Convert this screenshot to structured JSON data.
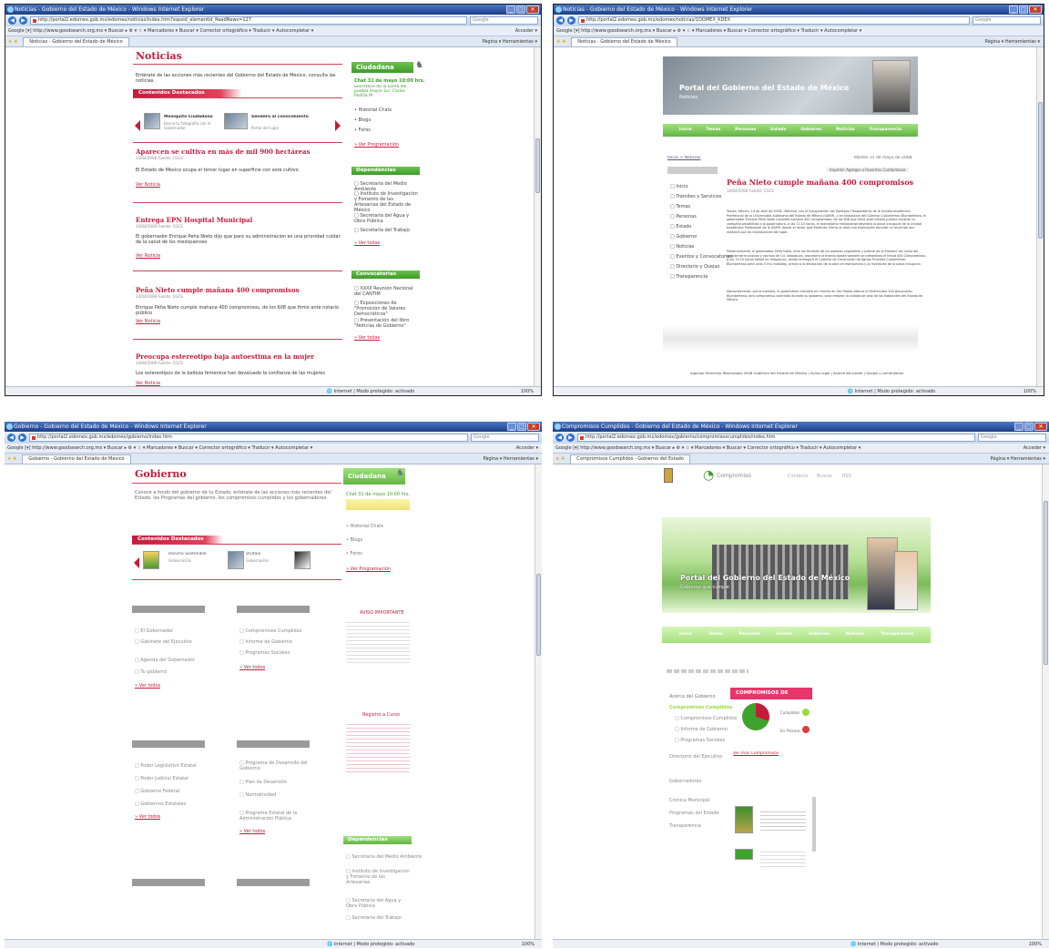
{
  "panel1": {
    "window_title": "Noticias - Gobierno del Estado de México - Windows Internet Explorer",
    "url": "http://portal2.edomex.gob.mx/edomex/noticias/index.htm?sspoid_elementId_ReadNews=127",
    "search_placeholder": "Google",
    "google_bar": "Google  [▾] http://www.goodsearch.org.mx   ▾ Buscar ▸ ⚙ ▾ ☆ ▾ Marcadores ▾  Buscar ▾  Corrector ortográfico ▾  Traducir ▾  Autocompletar ▾",
    "google_right": "Acceder ▾",
    "tab": "Noticias - Gobierno del Estado de México",
    "tools": "Página ▾  Herramientas ▾",
    "page_title": "Noticias",
    "intro": "Entérate de las acciones más recientes del Gobierno del Estado de México, consulta las noticias.",
    "featured_header": "Contenidos Destacados",
    "featured": [
      {
        "title": "Mexiquito Ciudadano",
        "text": "Busca tu fotografía con el Gobernador"
      },
      {
        "title": "Sendero al conocimiento",
        "text": "Portal del lugar"
      }
    ],
    "news": [
      {
        "title": "Aparecen se cultiva en más de mil 900 hectáreas",
        "meta": "15/04/2008 Fuente: CGCS",
        "body": "El Estado de México ocupa el tercer lugar en superficie con este cultivo",
        "more": "Ver Noticia"
      },
      {
        "title": "Entrega EPN Hospital Municipal",
        "meta": "14/04/2008 Fuente: CGCS",
        "body": "El gobernador Enrique Peña Nieto dijo que para su administración es una prioridad cuidar de la salud de los mexiquenses",
        "more": "Ver Noticia"
      },
      {
        "title": "Peña Nieto cumple mañana 400 compromisos",
        "meta": "14/04/2008 Fuente: CGCS",
        "body": "Enrique Peña Nieto cumple mañana 400 compromisos, de los 608 que firmó ante notario público",
        "more": "Ver Noticia"
      },
      {
        "title": "Preocupa estereotipo baja autoestima en la mujer",
        "meta": "14/04/2008 Fuente: CGCS",
        "body": "Los estereotipos de la belleza femenina han devaluado la confianza de las mujeres",
        "more": "Ver Noticia"
      }
    ],
    "side": {
      "cuidadana": "Ciudadana",
      "chat_title": "Chat 31 de mayo 10:00 hrs.",
      "chat_text": "Secretario de la Loma del pueblo mayor Lic. Carlos Padilla M",
      "items": [
        "Historial Chats",
        "Blogs",
        "Foros"
      ],
      "prog": "Ver Programación",
      "dep_header": "Dependencias",
      "deps": [
        "Secretaría del Medio Ambiente",
        "Instituto de Investigación y Fomento de las Artesanías del Estado de México",
        "Secretaría del Agua y Obra Pública",
        "Secretaría del Trabajo"
      ],
      "dep_more": "Ver todas",
      "conv_header": "Convocatorias",
      "convs": [
        "XXXII Reunión Nacional del CANTIM",
        "Exposiciones de \"Promoción de Valores Democráticos\"",
        "Presentación del libro \"Noticias de Gobierno\""
      ],
      "conv_more": "Ver todas"
    },
    "status": "Internet | Modo protegido: activado",
    "zoom": "100%"
  },
  "panel2": {
    "window_title": "Noticias - Gobierno del Estado de México - Windows Internet Explorer",
    "url": "http://portal2.edomex.gob.mx/edomex/noticias/1DOMEX_KDEX",
    "tab": "Noticias - Gobierno del Estado de México",
    "tools": "Página ▾  Herramientas ▾",
    "banner_title": "Portal del Gobierno del Estado de México",
    "banner_sub": "Noticias",
    "menu": [
      "Inicio",
      "Trámites y Servicios",
      "Temas",
      "Personas",
      "Estado",
      "Gobierno",
      "Noticias",
      "Directorio y Comunicados",
      "Directorio y Quejas",
      "Transparencia"
    ],
    "breadcrumb": "Inicio > Noticias",
    "date": "Martes 15 de mayo de 2008",
    "tools_links": "Imprimir  Agregar a Favoritos  Contáctanos",
    "left_items": [
      "Inicio",
      "Trámites y Servicios",
      "Temas",
      "Personas",
      "Estado",
      "Gobierno",
      "Noticias",
      "Eventos y Convocatorias",
      "Directorio y Quejas",
      "Transparencia"
    ],
    "article_title": "Peña Nieto cumple mañana 400 compromisos",
    "article_meta": "14/04/2008 Fuente: CGCS",
    "paragraphs": [
      "Toluca, México, 14 de abril de 2008.- Mañana, con la inauguración del Santiago Tianguistenco de la Unidad Académica Profesional de la Universidad Autónoma del Estado de México (UAEM), y en Ixtapaluca del Colector Cuauhtémoc Blumbertano, el gobernador Enrique Peña Nieto cumplirá mañana 400 compromisos, de los 608 que firmó ante notario público durante su campaña proselitista a la gubernatura. A las 11:15 horas, el mandatario mexiquense develará la placa inaugural de la Unidad Académica Profesional de la UAEM, donde el rector José Martínez Vilchis le dará una explicación durante un recorrido que realizará por las instalaciones del lugar.",
      "Posteriormente, el gobernador Peña Nieto, ante los titulares de los poderes Legislativo y Judicial de la Entidad, así como del presidente municipal y vecinos de Cd. Ixtapaluca, procederá al evento donde también se presentará el mitad 400 Compromisos. A las 13:15 horas estará en Ixtapaluca, donde entregará el Colector de Conducción de Aguas Pluviales Cuauhtémoc Blumbertano ante unos 5 mil invitados, previo a la develación de la obra en marquesina y la revelación de la placa inaugural.",
      "Adicionalmente, por la mañana, el gobernador cumplirá en marcha en San Mateo Atenco el Distribuidor Vial Aeropuerto Blumbertano, otro compromiso contraído durante su gobierno, para mejorar la calidad de vida de los habitantes del Estado de México."
    ],
    "footer": "Algunos Derechos Reservados 2008 Gobierno del Estado de México | Aviso Legal | Acerca del portal | Quejas y comentarios",
    "status": "Internet | Modo protegido: activado",
    "zoom": "100%"
  },
  "panel3": {
    "window_title": "Gobierno - Gobierno del Estado de México - Windows Internet Explorer",
    "url": "http://portal2.edomex.gob.mx/edomex/gobierno/index.htm",
    "tab": "Gobierno - Gobierno del Estado de México",
    "tools": "Página ▾  Herramientas ▾",
    "page_title": "Gobierno",
    "intro": "Conoce a fondo del gobierno de tu Estado, entérate de las acciones más recientes del Estado, los Programas del gobierno, los compromisos cumplidos y los gobernadores.",
    "featured_header": "Contenidos Destacados",
    "featured": [
      {
        "title": "Rancho Sostenible",
        "text": "Gobernación"
      },
      {
        "title": "Visítalo",
        "text": "Gobernación"
      }
    ],
    "cols": [
      {
        "items": [
          "El Gobernador",
          "Gabinete del Ejecutivo",
          "Agenda del Gobernador",
          "Tu gobierno"
        ],
        "more": "Ver todos"
      },
      {
        "items": [
          "Compromisos Cumplidos",
          "Informe de Gobierno",
          "Programas Sociales"
        ],
        "more": "Ver todos"
      },
      {
        "items": [
          "Poder Legislativo Estatal",
          "Poder Judicial Estatal",
          "Gobierno Federal",
          "Gobiernos Estatales"
        ],
        "more": "Ver todos"
      },
      {
        "items": [
          "Programa de Desarrollo del Gobierno",
          "Plan de Desarrollo",
          "Normatividad",
          "Programa Estatal de la Administración Pública"
        ],
        "more": "Ver todos"
      }
    ],
    "side": {
      "cuidadana": "Ciudadana",
      "chat_title": "Chat 31 de mayo 10:00 hrs.",
      "items": [
        "Historial Chats",
        "Blogs",
        "Foros"
      ],
      "prog": "Ver Programación",
      "aviso_title": "AVISO IMPORTANTE",
      "tramite_title": "Registro a Curso",
      "dep_header": "Dependencias",
      "deps": [
        "Secretaría del Medio Ambiente",
        "Instituto de Investigación y Fomento de las Artesanías",
        "Secretaría del Agua y Obra Pública",
        "Secretaría del Trabajo"
      ]
    },
    "status": "Internet | Modo protegido: activado",
    "zoom": "100%"
  },
  "panel4": {
    "window_title": "Compromisos Cumplidos - Gobierno del Estado de México - Windows Internet Explorer",
    "url": "http://portal2.edomex.gob.mx/edomex/gobierno/compromisoscumplidos/index.htm",
    "tab": "Compromisos Cumplidos - Gobierno del Estado",
    "tools": "Página ▾  Herramientas ▾",
    "logo_text": "Compromiso",
    "top_links": [
      "Contacto",
      "Buscar",
      "RSS"
    ],
    "banner_title": "Portal del Gobierno del Estado de México",
    "banner_sub": "Gobierno que cumple",
    "menu": [
      "Inicio",
      "Trámites y Servicios",
      "Temas",
      "Personas",
      "Estado",
      "Gobierno",
      "Noticias",
      "Directorio y Comunicados",
      "Denuncias y Quejas",
      "Transparencia"
    ],
    "box_title": "COMPROMISOS DE GOBIERNO",
    "legend": [
      "Cumplidos",
      "En Proceso"
    ],
    "box_link": "Ver más Compromisos",
    "left_items": [
      "Acerca del Gobierno",
      "Compromisos Cumplidos",
      "Informe de Gobierno",
      "Programas Sociales",
      "Directorio del Ejecutivo",
      "Gobernadores",
      "Crónica Municipal",
      "Programas del Estado",
      "Transparencia"
    ],
    "status": "Internet | Modo protegido: activado",
    "zoom": "100%"
  }
}
